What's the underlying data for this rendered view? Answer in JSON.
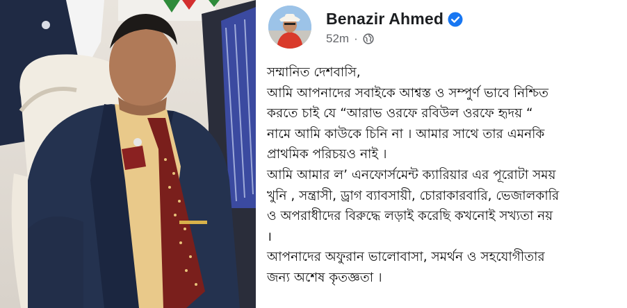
{
  "post": {
    "author_name": "Benazir Ahmed",
    "timestamp": "52m",
    "separator": "·",
    "icons": {
      "verified": "verified-badge-icon",
      "audience": "globe-icon"
    },
    "colors": {
      "name": "#1c1e21",
      "meta": "#65676b",
      "verified": "#1877f2",
      "body": "#111111"
    },
    "body_lines": [
      "সম্মানিত দেশবাসি,",
      "আমি আপনাদের সবাইকে আশ্বস্ত ও সম্পুর্ণ ভাবে নিশ্চিত",
      "করতে চাই যে “আরাভ ওরফে রবিউল ওরফে হৃদয় “",
      "নামে আমি কাউকে চিনি না । আমার সাথে তার এমনকি",
      "প্রাথমিক পরিচয়ও নাই ।",
      "আমি আমার ল’ এনফোর্সমেন্ট ক্যারিয়ার এর পূরোটা সময়",
      "খুনি , সন্ত্রাসী, ড্রাগ ব্যাবসায়ী, চোরাকারবারি, ভেজালকারি",
      "ও অপরাধীদের বিরুদ্ধে লড়াই করেছি কখনোই সখ্যতা নয়",
      "।",
      "আপনাদের অফুরান ভালোবাসা, সমর্থন ও সহযোগীতার",
      "জন্য অশেষ কৃতজ্ঞতা ।"
    ]
  }
}
